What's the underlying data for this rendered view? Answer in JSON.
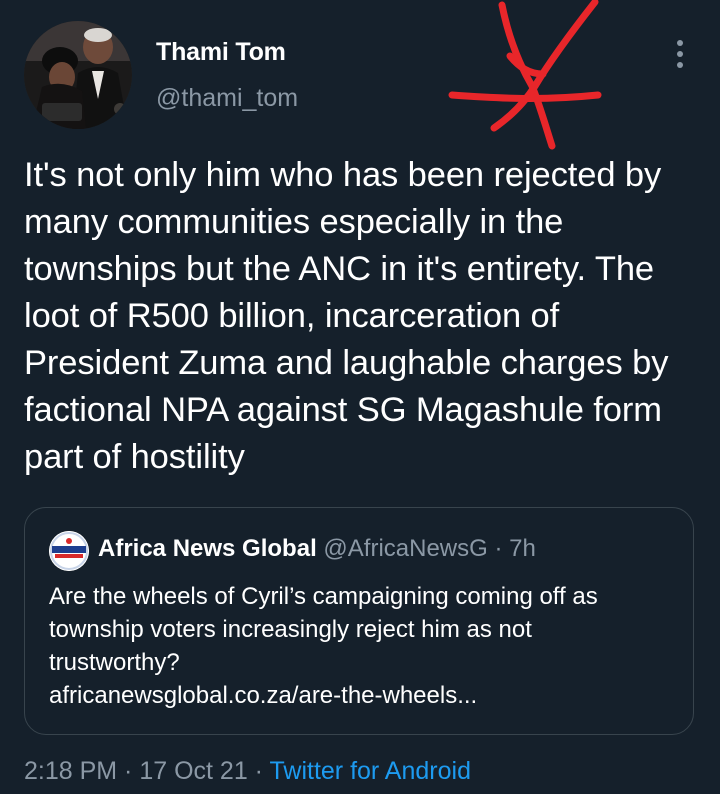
{
  "tweet": {
    "author_name": "Thami Tom",
    "author_handle": "@thami_tom",
    "text": "It's not only him who has been rejected by many communities especially in the townships but the ANC in it's entirety. The loot of R500 billion, incarceration of President Zuma and laughable charges by factional NPA against SG Magashule form part of hostility",
    "time": "2:18 PM",
    "date": "17 Oct 21",
    "separator": " · ",
    "source": "Twitter for Android"
  },
  "quoted_tweet": {
    "author_name": "Africa News Global",
    "author_handle": "@AfricaNewsG",
    "age": "7h",
    "text_line1": "Are the wheels of Cyril’s campaigning coming off as township voters increasingly reject him as not trustworthy?",
    "link": "africanewsglobal.co.za/are-the-wheels..."
  },
  "icons": {
    "more": "more-vertical-icon",
    "annotation": "red-scribble-mark"
  },
  "colors": {
    "background": "#15202b",
    "primary_text": "#ffffff",
    "secondary_text": "#8b98a5",
    "link": "#1d9bf0",
    "border": "#38444d",
    "scribble": "#e8262a"
  }
}
